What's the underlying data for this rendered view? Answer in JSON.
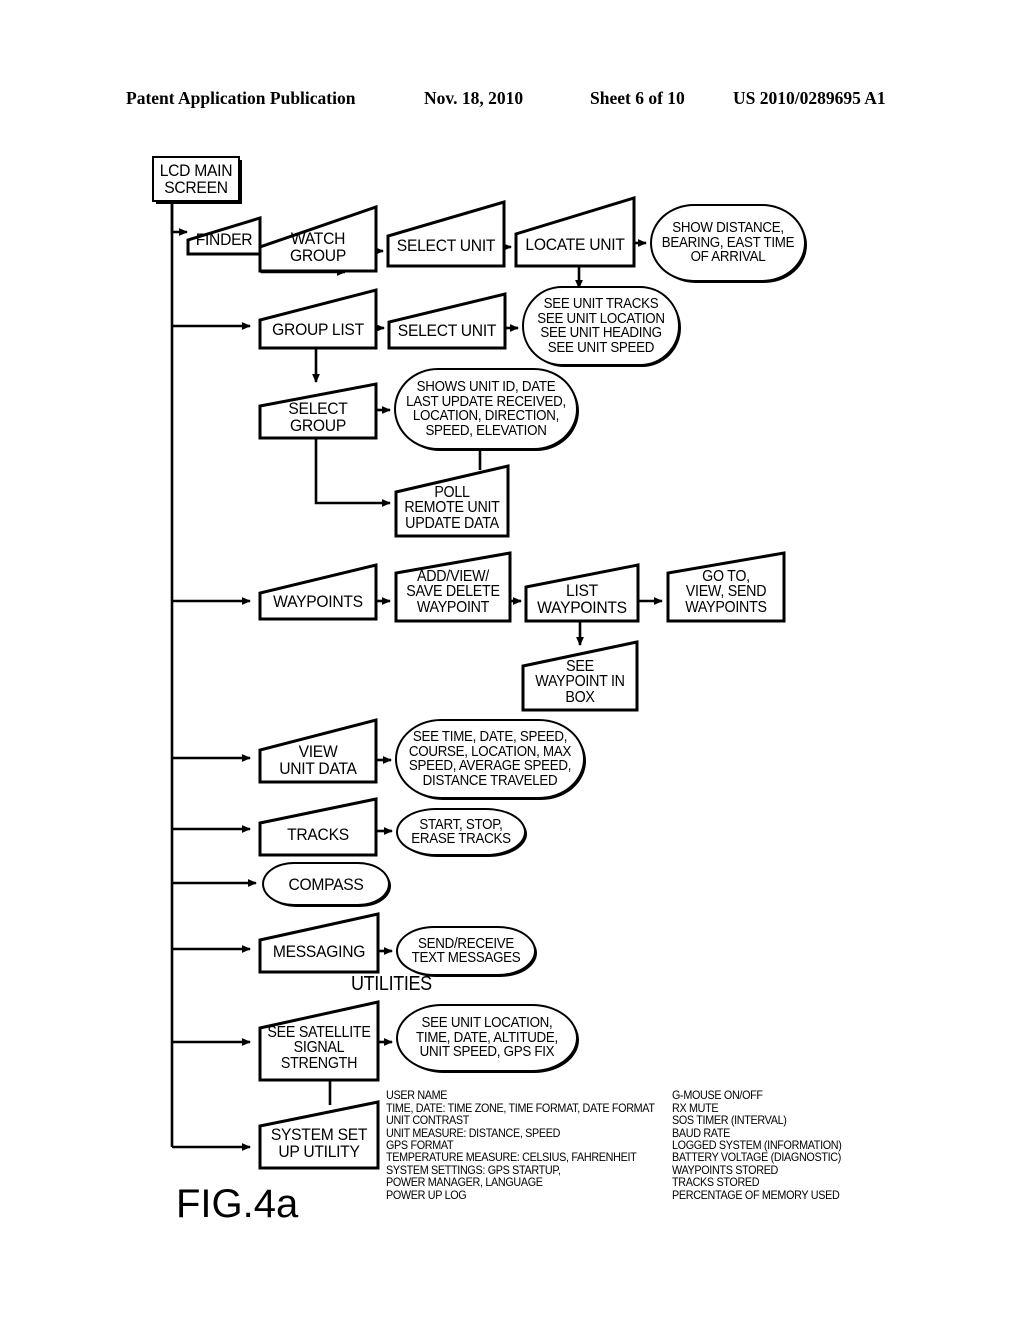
{
  "header": {
    "publication": "Patent Application Publication",
    "date": "Nov. 18, 2010",
    "sheet": "Sheet 6 of 10",
    "patent_number": "US 2010/0289695 A1"
  },
  "figure": {
    "label": "FIG.4a",
    "section_label": "UTILITIES"
  },
  "nodes": {
    "lcd_main_screen": "LCD MAIN\nSCREEN",
    "finder": "FINDER",
    "watch_group": "WATCH\nGROUP",
    "select_unit_1": "SELECT UNIT",
    "locate_unit": "LOCATE UNIT",
    "show_distance": "SHOW DISTANCE,\nBEARING, EAST TIME\nOF ARRIVAL",
    "group_list": "GROUP LIST",
    "select_unit_2": "SELECT UNIT",
    "see_unit_info": "SEE UNIT TRACKS\nSEE UNIT LOCATION\nSEE UNIT HEADING\nSEE UNIT SPEED",
    "select_group": "SELECT\nGROUP",
    "shows_unit_id": "SHOWS UNIT ID, DATE\nLAST UPDATE RECEIVED,\nLOCATION, DIRECTION,\nSPEED, ELEVATION",
    "poll_remote_unit": "POLL\nREMOTE UNIT\nUPDATE DATA",
    "waypoints": "WAYPOINTS",
    "add_view_save_delete": "ADD/VIEW/\nSAVE DELETE\nWAYPOINT",
    "list_waypoints": "LIST\nWAYPOINTS",
    "go_to_view_send": "GO TO,\nVIEW, SEND\nWAYPOINTS",
    "see_waypoint_in_box": "SEE\nWAYPOINT IN\nBOX",
    "view_unit_data": "VIEW\nUNIT DATA",
    "see_time_date_speed": "SEE TIME, DATE, SPEED,\nCOURSE, LOCATION, MAX\nSPEED, AVERAGE SPEED,\nDISTANCE TRAVELED",
    "tracks": "TRACKS",
    "start_stop_erase": "START, STOP,\nERASE TRACKS",
    "compass": "COMPASS",
    "messaging": "MESSAGING",
    "send_receive_text": "SEND/RECEIVE\nTEXT MESSAGES",
    "see_satellite_signal": "SEE SATELLITE\nSIGNAL\nSTRENGTH",
    "see_unit_location": "SEE UNIT LOCATION,\nTIME, DATE, ALTITUDE,\nUNIT SPEED, GPS FIX",
    "system_set_up_utility": "SYSTEM SET\nUP UTILITY"
  },
  "system_setup_options": {
    "left_column": "USER NAME\nTIME, DATE: TIME ZONE, TIME FORMAT, DATE FORMAT\nUNIT CONTRAST\nUNIT MEASURE: DISTANCE, SPEED\nGPS FORMAT\nTEMPERATURE MEASURE: CELSIUS, FAHRENHEIT\nSYSTEM SETTINGS: GPS STARTUP,\n     POWER MANAGER, LANGUAGE\nPOWER UP LOG",
    "right_column": "G-MOUSE ON/OFF\nRX MUTE\nSOS TIMER (INTERVAL)\nBAUD RATE\nLOGGED SYSTEM (INFORMATION)\nBATTERY VOLTAGE (DIAGNOSTIC)\nWAYPOINTS STORED\nTRACKS STORED\nPERCENTAGE OF MEMORY USED"
  },
  "colors": {
    "ink": "#000000",
    "paper": "#ffffff"
  }
}
